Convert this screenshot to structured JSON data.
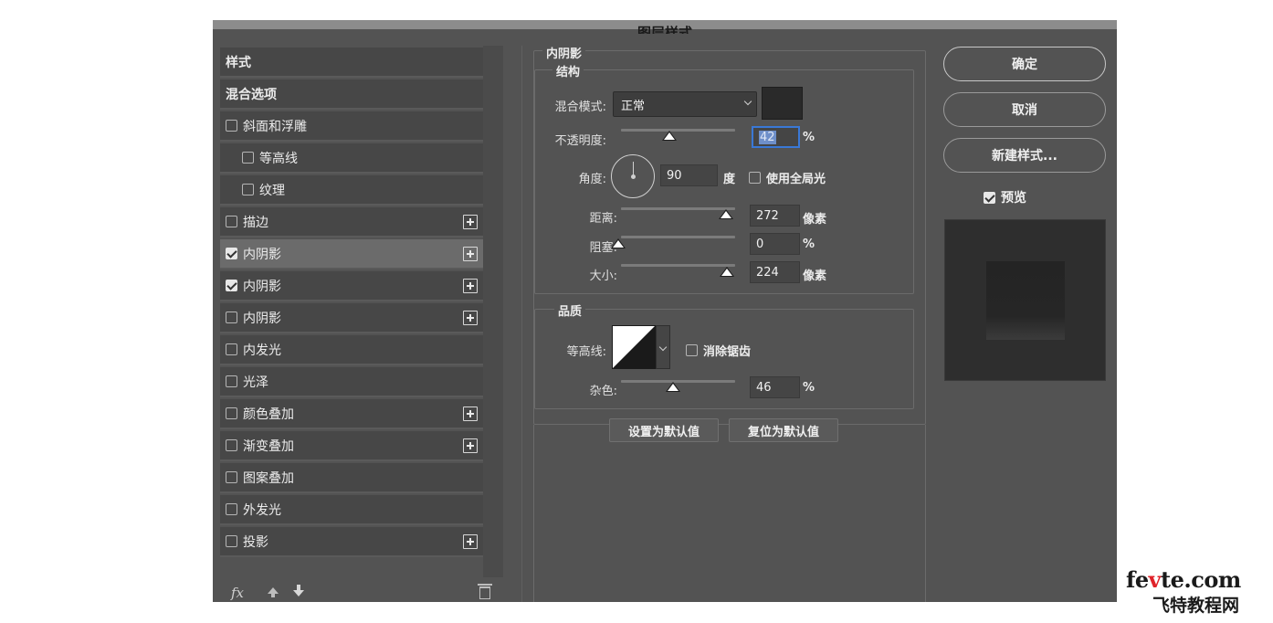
{
  "window": {
    "title": "图层样式"
  },
  "sidebar": {
    "items": [
      {
        "label": "样式",
        "checkbox": false,
        "checked": false,
        "plus": false,
        "selected": false,
        "indent": 0,
        "bold": true
      },
      {
        "label": "混合选项",
        "checkbox": false,
        "checked": false,
        "plus": false,
        "selected": false,
        "indent": 0,
        "bold": true
      },
      {
        "label": "斜面和浮雕",
        "checkbox": true,
        "checked": false,
        "plus": false,
        "selected": false,
        "indent": 0,
        "bold": false
      },
      {
        "label": "等高线",
        "checkbox": true,
        "checked": false,
        "plus": false,
        "selected": false,
        "indent": 1,
        "bold": false
      },
      {
        "label": "纹理",
        "checkbox": true,
        "checked": false,
        "plus": false,
        "selected": false,
        "indent": 1,
        "bold": false
      },
      {
        "label": "描边",
        "checkbox": true,
        "checked": false,
        "plus": true,
        "selected": false,
        "indent": 0,
        "bold": false
      },
      {
        "label": "内阴影",
        "checkbox": true,
        "checked": true,
        "plus": true,
        "selected": true,
        "indent": 0,
        "bold": false
      },
      {
        "label": "内阴影",
        "checkbox": true,
        "checked": true,
        "plus": true,
        "selected": false,
        "indent": 0,
        "bold": false
      },
      {
        "label": "内阴影",
        "checkbox": true,
        "checked": false,
        "plus": true,
        "selected": false,
        "indent": 0,
        "bold": false
      },
      {
        "label": "内发光",
        "checkbox": true,
        "checked": false,
        "plus": false,
        "selected": false,
        "indent": 0,
        "bold": false
      },
      {
        "label": "光泽",
        "checkbox": true,
        "checked": false,
        "plus": false,
        "selected": false,
        "indent": 0,
        "bold": false
      },
      {
        "label": "颜色叠加",
        "checkbox": true,
        "checked": false,
        "plus": true,
        "selected": false,
        "indent": 0,
        "bold": false
      },
      {
        "label": "渐变叠加",
        "checkbox": true,
        "checked": false,
        "plus": true,
        "selected": false,
        "indent": 0,
        "bold": false
      },
      {
        "label": "图案叠加",
        "checkbox": true,
        "checked": false,
        "plus": false,
        "selected": false,
        "indent": 0,
        "bold": false
      },
      {
        "label": "外发光",
        "checkbox": true,
        "checked": false,
        "plus": false,
        "selected": false,
        "indent": 0,
        "bold": false
      },
      {
        "label": "投影",
        "checkbox": true,
        "checked": false,
        "plus": true,
        "selected": false,
        "indent": 0,
        "bold": false
      }
    ],
    "footer": {
      "fx_label": "fx"
    }
  },
  "panel": {
    "section_title": "内阴影",
    "structure": {
      "title": "结构",
      "blend_mode_label": "混合模式:",
      "blend_mode_value": "正常",
      "shadow_color": "#2a2a2a",
      "opacity_label": "不透明度:",
      "opacity_value": "42",
      "opacity_unit": "%",
      "angle_label": "角度:",
      "angle_value": "90",
      "angle_unit": "度",
      "global_light_label": "使用全局光",
      "global_light_checked": false,
      "distance_label": "距离:",
      "distance_value": "272",
      "distance_unit": "像素",
      "choke_label": "阻塞:",
      "choke_value": "0",
      "choke_unit": "%",
      "size_label": "大小:",
      "size_value": "224",
      "size_unit": "像素"
    },
    "quality": {
      "title": "品质",
      "contour_label": "等高线:",
      "antialias_label": "消除锯齿",
      "antialias_checked": false,
      "noise_label": "杂色:",
      "noise_value": "46",
      "noise_unit": "%"
    },
    "buttons": {
      "make_default": "设置为默认值",
      "reset_default": "复位为默认值"
    }
  },
  "actions": {
    "ok": "确定",
    "cancel": "取消",
    "new_style": "新建样式...",
    "preview_label": "预览",
    "preview_checked": true
  },
  "watermark": {
    "line1_pre": "fe",
    "line1_accent": "v",
    "line1_post": "te.com",
    "line2": "飞特教程网"
  }
}
